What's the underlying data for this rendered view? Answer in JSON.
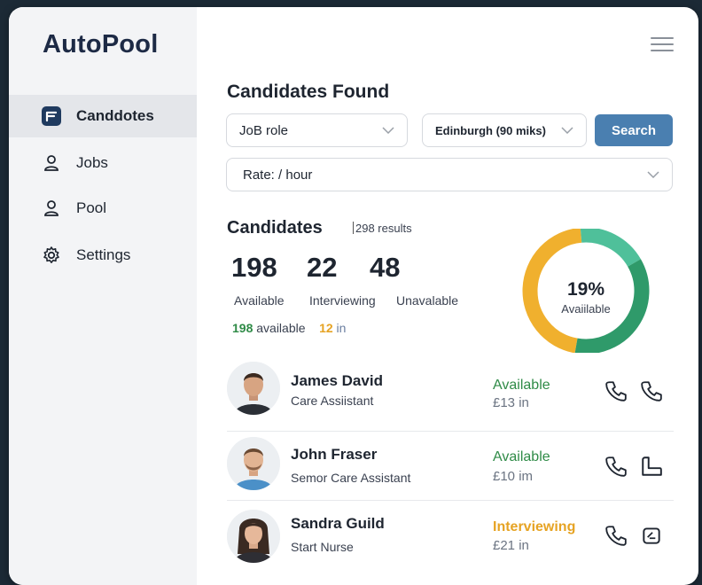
{
  "app": {
    "title": "AutoPool"
  },
  "sidebar": {
    "items": [
      {
        "label": "Canddotes",
        "icon": "candidates-icon",
        "active": true
      },
      {
        "label": "Jobs",
        "icon": "person-icon",
        "active": false
      },
      {
        "label": "Pool",
        "icon": "person-icon",
        "active": false
      },
      {
        "label": "Settings",
        "icon": "gear-icon",
        "active": false
      }
    ]
  },
  "search": {
    "title": "Candidates Found",
    "job_role": "JoB role",
    "location": "Edinburgh (90 miks)",
    "rate": "Rate: / hour",
    "button": "Search"
  },
  "candidates": {
    "title": "Candidates",
    "results": "298 results",
    "stats": [
      {
        "value": "198",
        "label": "Available"
      },
      {
        "value": "22",
        "label": "Interviewing"
      },
      {
        "value": "48",
        "label": "Unavalable"
      }
    ],
    "summary": {
      "available_count": "198",
      "available_text": "available",
      "in_count": "12",
      "in_text": "in"
    },
    "donut": {
      "percent_label": "19%",
      "caption": "Avaiilable",
      "available_fraction": 0.19,
      "colors": {
        "green": "#2f9a6a",
        "teal": "#4fc09a",
        "amber": "#f0b02e"
      }
    },
    "list": [
      {
        "name": "James David",
        "role": "Care Assiistant",
        "status": "Available",
        "status_color": "#2f8b47",
        "rate": "£13 in"
      },
      {
        "name": "John Fraser",
        "role": "Semor Care Assistant",
        "status": "Available",
        "status_color": "#2f8b47",
        "rate": "£10 im"
      },
      {
        "name": "Sandra Guild",
        "role": "Start Nurse",
        "status": "Interviewing",
        "status_color": "#e6a323",
        "rate": "£21 in"
      }
    ]
  }
}
